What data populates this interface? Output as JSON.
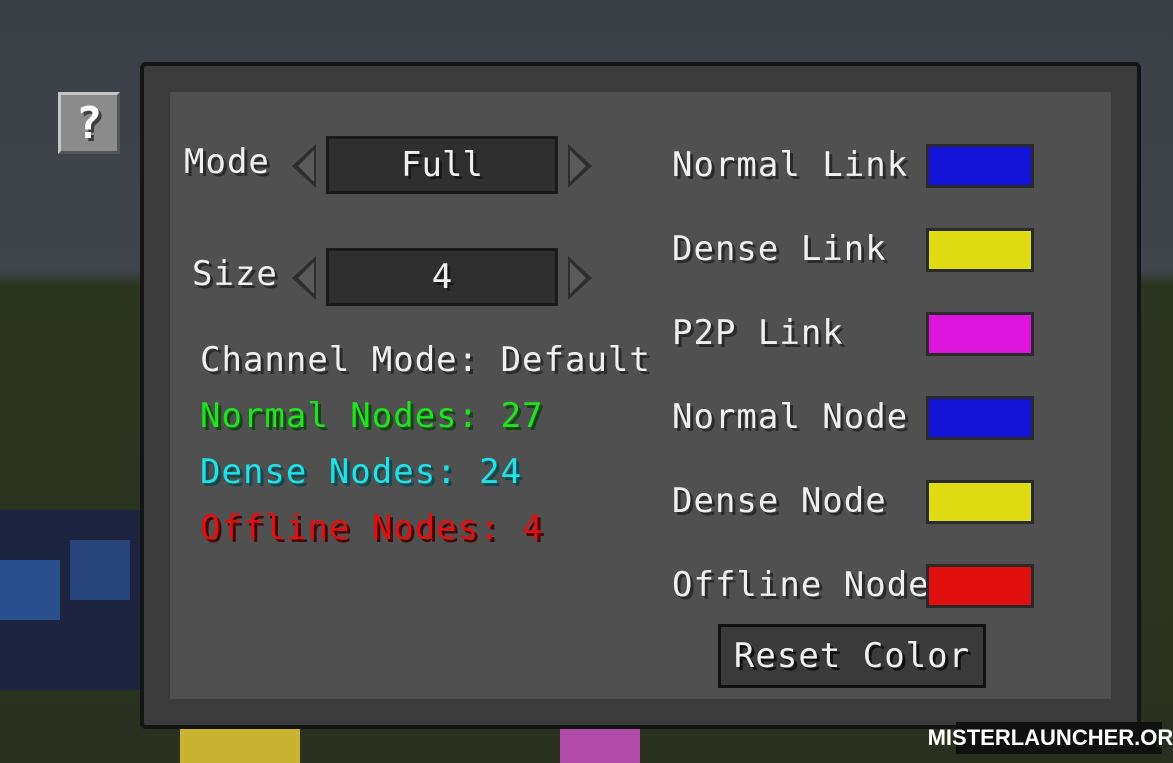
{
  "help_button": {
    "label": "?"
  },
  "settings": {
    "mode": {
      "label": "Mode",
      "value": "Full"
    },
    "size": {
      "label": "Size",
      "value": "4"
    }
  },
  "info": {
    "channel_mode": "Channel Mode: Default",
    "normal_nodes": "Normal Nodes: 27",
    "dense_nodes": "Dense Nodes: 24",
    "offline_nodes": "Offline Nodes: 4",
    "colors": {
      "normal_nodes": "#22e022",
      "dense_nodes": "#22e0e8",
      "offline_nodes": "#e01010"
    }
  },
  "color_settings": [
    {
      "label": "Normal Link",
      "color": "#1414d8"
    },
    {
      "label": "Dense Link",
      "color": "#e0dc14"
    },
    {
      "label": "P2P Link",
      "color": "#dc14dc"
    },
    {
      "label": "Normal Node",
      "color": "#1414d8"
    },
    {
      "label": "Dense Node",
      "color": "#e0dc14"
    },
    {
      "label": "Offline Node",
      "color": "#e01010"
    }
  ],
  "reset_button": {
    "label": "Reset Color"
  },
  "watermark": "MISTERLAUNCHER.ORG"
}
